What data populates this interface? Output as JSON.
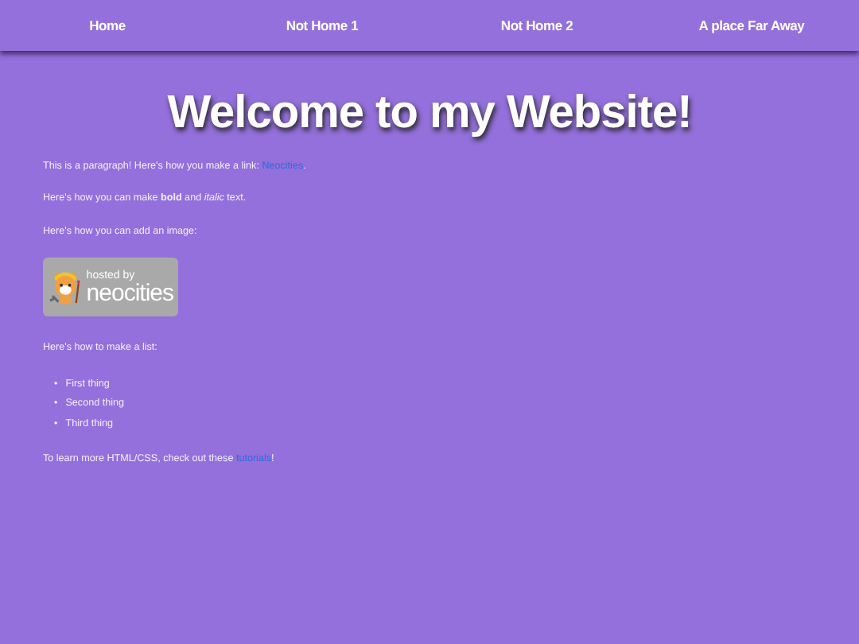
{
  "nav": [
    {
      "label": "Home"
    },
    {
      "label": "Not Home 1"
    },
    {
      "label": "Not Home 2"
    },
    {
      "label": "A place Far Away"
    }
  ],
  "heading": "Welcome to my Website!",
  "link_paragraph": {
    "before": "This is a paragraph! Here's how you make a link: ",
    "link": "Neocities",
    "after": "."
  },
  "format_paragraph": "Here's how you can make **bold** and *italic* text.",
  "image_paragraph": "Here's how you can add an image:",
  "badge": {
    "top": "hosted by",
    "bottom": "neocities"
  },
  "list_intro": "Here's how to make a list:",
  "list": [
    {
      "bullet": "•",
      "text": "First thing"
    },
    {
      "bullet": "•",
      "text": "Second thing"
    },
    {
      "bullet": "•",
      "text": "Third thing"
    }
  ],
  "tutorial_paragraph": {
    "before": "To learn more HTML/CSS, check out these ",
    "link": "tutorials",
    "after": "!"
  }
}
